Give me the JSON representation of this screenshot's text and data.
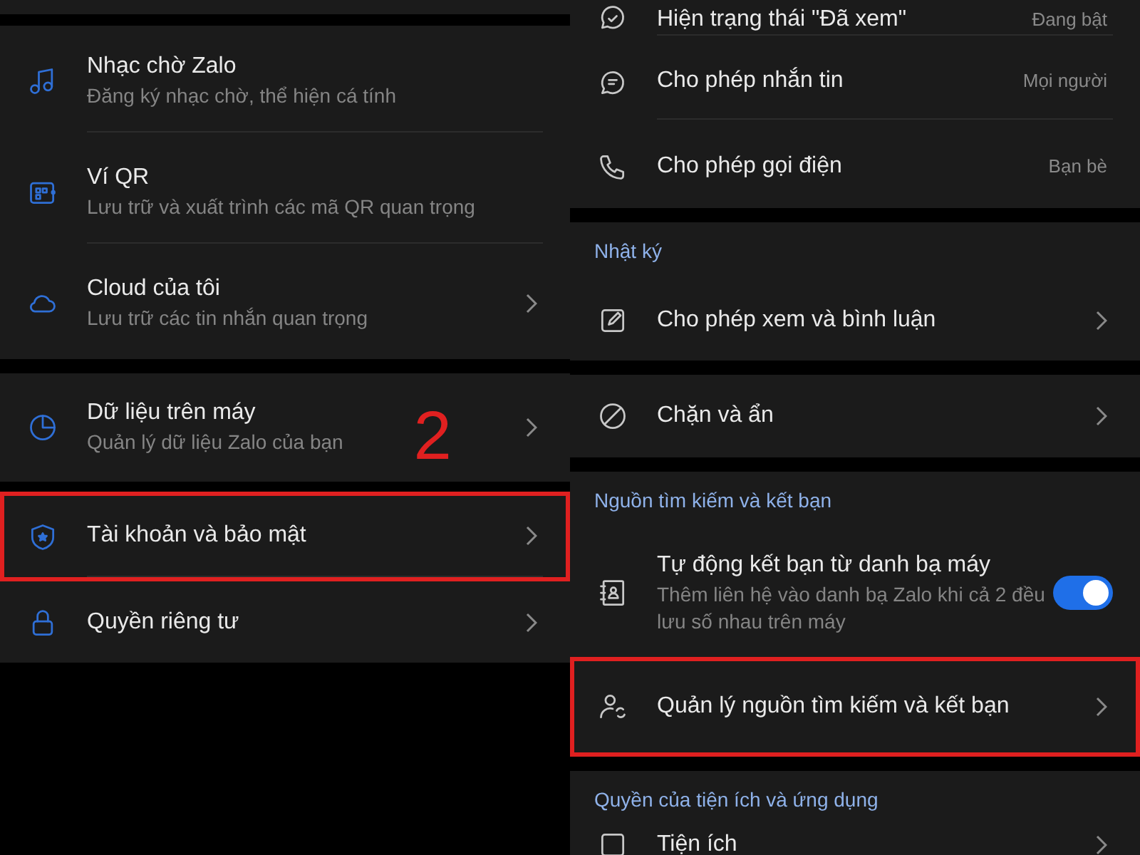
{
  "left": {
    "sections": [
      {
        "items": [
          {
            "kind": "plain",
            "title": "Nhạc chờ Zalo",
            "subtitle": "Đăng ký nhạc chờ, thể hiện cá tính",
            "highlighted": false
          },
          {
            "kind": "plain",
            "title": "Ví QR",
            "subtitle": "Lưu trữ và xuất trình các mã QR quan trọng",
            "highlighted": false
          },
          {
            "kind": "link",
            "title": "Cloud của tôi",
            "subtitle": "Lưu trữ các tin nhắn quan trọng",
            "highlighted": false
          }
        ]
      },
      {
        "items": [
          {
            "kind": "link",
            "title": "Dữ liệu trên máy",
            "subtitle": "Quản lý dữ liệu Zalo của bạn",
            "annotation": "2",
            "highlighted": false
          }
        ]
      },
      {
        "items": [
          {
            "kind": "link",
            "title": "Tài khoản và bảo mật",
            "highlighted": true
          },
          {
            "kind": "link",
            "title": "Quyền riêng tư",
            "highlighted": false
          }
        ]
      }
    ]
  },
  "right": {
    "sections": [
      {
        "items": [
          {
            "kind": "value",
            "title": "Hiện trạng thái \"Đã xem\"",
            "value": "Đang bật",
            "highlighted": false
          },
          {
            "kind": "value",
            "title": "Cho phép nhắn tin",
            "value": "Mọi người",
            "highlighted": false
          },
          {
            "kind": "value",
            "title": "Cho phép gọi điện",
            "value": "Bạn bè",
            "highlighted": false
          }
        ]
      },
      {
        "header": "Nhật ký",
        "items": [
          {
            "kind": "link",
            "title": "Cho phép xem và bình luận",
            "highlighted": false
          }
        ]
      },
      {
        "items": [
          {
            "kind": "link",
            "title": "Chặn và ẩn",
            "highlighted": false
          }
        ]
      },
      {
        "header": "Nguồn tìm kiếm và kết bạn",
        "items": [
          {
            "kind": "toggle",
            "title": "Tự động kết bạn từ danh bạ máy",
            "subtitle": "Thêm liên hệ vào danh bạ Zalo khi cả 2 đều lưu số nhau trên máy",
            "on": true,
            "highlighted": false
          },
          {
            "kind": "link",
            "title": "Quản lý nguồn tìm kiếm và kết bạn",
            "highlighted": true
          }
        ]
      },
      {
        "header": "Quyền của tiện ích và ứng dụng",
        "items": [
          {
            "kind": "link",
            "title": "Tiện ích",
            "highlighted": false
          }
        ]
      }
    ]
  }
}
